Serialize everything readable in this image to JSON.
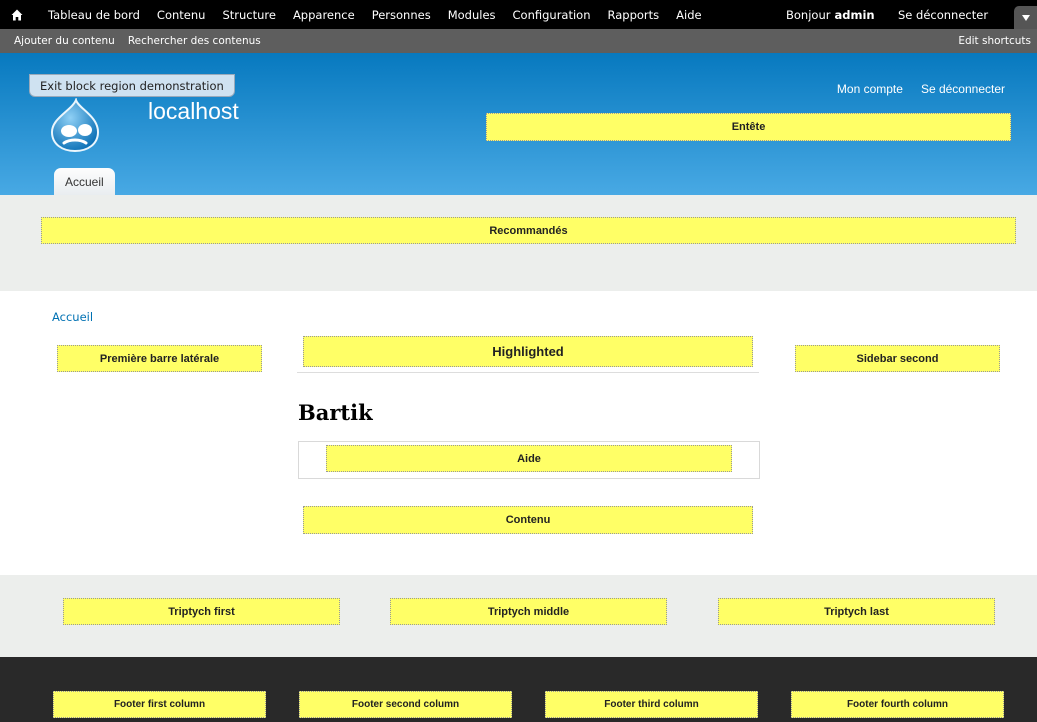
{
  "toolbar": {
    "nav": [
      "Tableau de bord",
      "Contenu",
      "Structure",
      "Apparence",
      "Personnes",
      "Modules",
      "Configuration",
      "Rapports",
      "Aide"
    ],
    "greeting": "Bonjour",
    "username": "admin",
    "logout": "Se déconnecter"
  },
  "shortcuts": {
    "items": [
      "Ajouter du contenu",
      "Rechercher des contenus"
    ],
    "edit": "Edit shortcuts"
  },
  "header": {
    "exit_demo": "Exit block region demonstration",
    "site_name": "localhost",
    "secondary_menu": [
      "Mon compte",
      "Se déconnecter"
    ],
    "tab": "Accueil",
    "region_header": "Entête"
  },
  "featured": {
    "region": "Recommandés"
  },
  "main": {
    "breadcrumb": "Accueil",
    "sidebar_first": "Première barre latérale",
    "highlighted": "Highlighted",
    "sidebar_second": "Sidebar second",
    "page_title": "Bartik",
    "help": "Aide",
    "content": "Contenu"
  },
  "triptych": {
    "first": "Triptych first",
    "middle": "Triptych middle",
    "last": "Triptych last"
  },
  "footer": {
    "first": "Footer first column",
    "second": "Footer second column",
    "third": "Footer third column",
    "fourth": "Footer fourth column"
  },
  "colors": {
    "toolbar": "#000000",
    "shortcut_bar": "#5e5e5e",
    "header_top": "#0779bf",
    "header_bottom": "#48a9e4",
    "region_fill": "#ffff66",
    "light_band": "#eceeec",
    "footer": "#292929",
    "link": "#0071b3"
  }
}
